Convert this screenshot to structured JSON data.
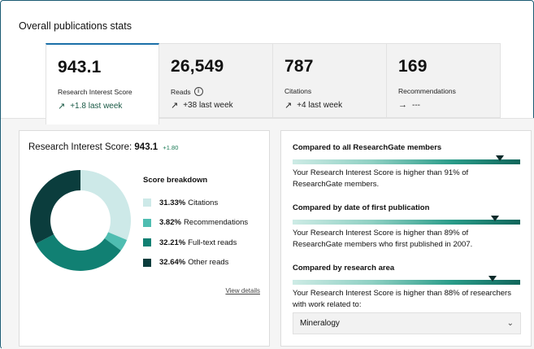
{
  "page_title": "Overall publications stats",
  "stat_cards": [
    {
      "value": "943.1",
      "label": "Research Interest Score",
      "trend_icon": "↗",
      "trend": "+1.8 last week"
    },
    {
      "value": "26,549",
      "label": "Reads",
      "info_icon": "i",
      "trend_icon": "↗",
      "trend": "+38 last week"
    },
    {
      "value": "787",
      "label": "Citations",
      "trend_icon": "↗",
      "trend": "+4 last week"
    },
    {
      "value": "169",
      "label": "Recommendations",
      "trend_icon": "→",
      "trend": "---"
    }
  ],
  "ris_panel": {
    "title_prefix": "Research Interest Score:",
    "score": "943.1",
    "delta": "+1.80",
    "breakdown_title": "Score breakdown",
    "breakdown": [
      {
        "pct": "31.33%",
        "label": "Citations",
        "value": 31.33,
        "color": "#cde9e8"
      },
      {
        "pct": "3.82%",
        "label": "Recommendations",
        "value": 3.82,
        "color": "#4fbdb1"
      },
      {
        "pct": "32.21%",
        "label": "Full-text reads",
        "value": 32.21,
        "color": "#118073"
      },
      {
        "pct": "32.64%",
        "label": "Other reads",
        "value": 32.64,
        "color": "#0b3d3d"
      }
    ],
    "view_details": "View details"
  },
  "comparisons": [
    {
      "title": "Compared to all ResearchGate members",
      "text": "Your Research Interest Score is higher than 91% of ResearchGate members.",
      "percentile": 91
    },
    {
      "title": "Compared by date of first publication",
      "text": "Your Research Interest Score is higher than 89% of ResearchGate members who first published in 2007.",
      "percentile": 89
    },
    {
      "title": "Compared by research area",
      "text": "Your Research Interest Score is higher than 88% of researchers with work related to:",
      "percentile": 88
    }
  ],
  "research_area_select": {
    "value": "Mineralogy",
    "chevron_icon": "chevron-down"
  }
}
